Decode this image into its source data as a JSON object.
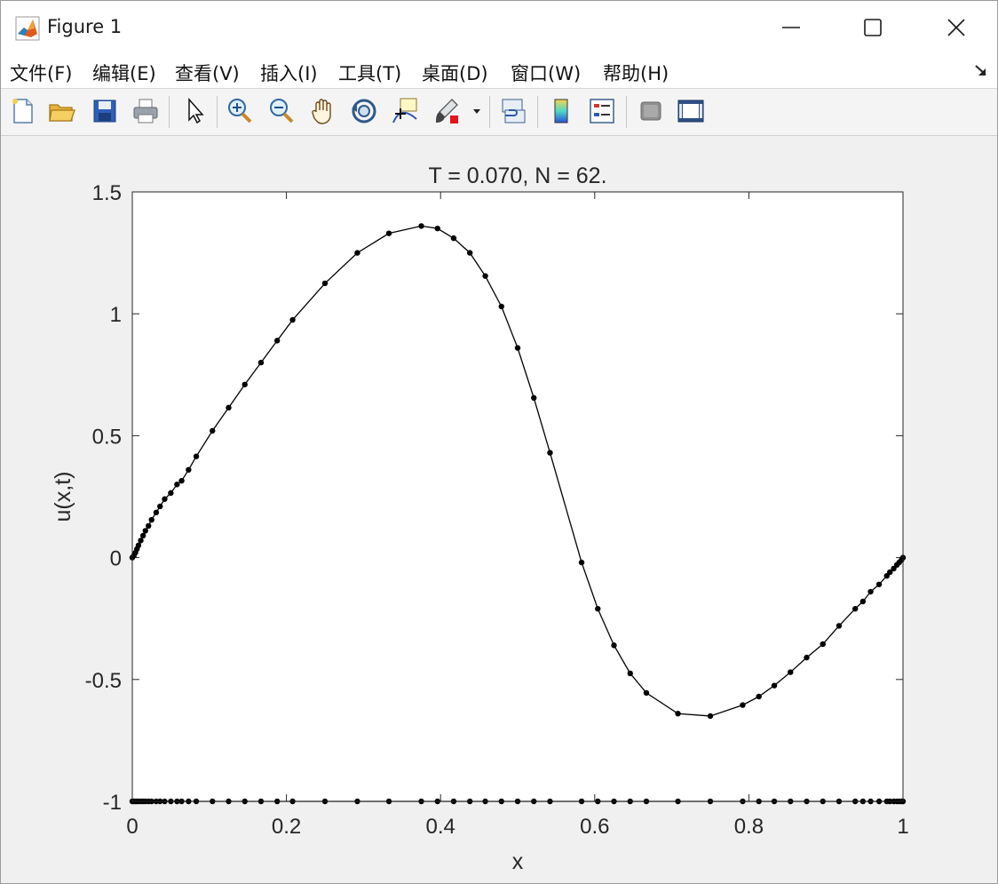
{
  "window": {
    "title": "Figure 1",
    "controls": [
      "minimize",
      "maximize",
      "close"
    ]
  },
  "menu": {
    "items": [
      {
        "label": "文件(F)",
        "name": "file"
      },
      {
        "label": "编辑(E)",
        "name": "edit"
      },
      {
        "label": "查看(V)",
        "name": "view"
      },
      {
        "label": "插入(I)",
        "name": "insert"
      },
      {
        "label": "工具(T)",
        "name": "tools"
      },
      {
        "label": "桌面(D)",
        "name": "desktop"
      },
      {
        "label": "窗口(W)",
        "name": "window"
      },
      {
        "label": "帮助(H)",
        "name": "help"
      }
    ]
  },
  "toolbar": {
    "buttons": [
      "new-figure-icon",
      "open-file-icon",
      "save-icon",
      "print-icon",
      "pointer-icon",
      "zoom-in-icon",
      "zoom-out-icon",
      "pan-hand-icon",
      "rotate-3d-icon",
      "data-cursor-icon",
      "brush-icon",
      "link-plot-icon",
      "colorbar-icon",
      "legend-icon",
      "hide-plot-tools-icon",
      "show-plot-tools-icon"
    ]
  },
  "chart_data": {
    "type": "line",
    "title": "T = 0.070,    N =  62.",
    "xlabel": "x",
    "ylabel": "u(x,t)",
    "xlim": [
      0,
      1
    ],
    "ylim": [
      -1,
      1.5
    ],
    "xticks": [
      "0",
      "0.2",
      "0.4",
      "0.6",
      "0.8",
      "1"
    ],
    "yticks": [
      "-1",
      "-0.5",
      "0",
      "0.5",
      "1",
      "1.5"
    ],
    "grid": false,
    "line_color": "#000000",
    "series": [
      {
        "marker": "dot",
        "x": [
          0,
          0.002,
          0.004,
          0.006,
          0.008,
          0.011,
          0.014,
          0.017,
          0.021,
          0.025,
          0.031,
          0.036,
          0.042,
          0.05,
          0.058,
          0.064,
          0.073,
          0.083,
          0.104,
          0.125,
          0.146,
          0.167,
          0.188,
          0.208,
          0.25,
          0.292,
          0.333,
          0.375,
          0.396,
          0.417,
          0.438,
          0.458,
          0.479,
          0.5,
          0.521,
          0.542,
          0.583,
          0.604,
          0.625,
          0.646,
          0.667,
          0.708,
          0.75,
          0.792,
          0.813,
          0.833,
          0.854,
          0.875,
          0.896,
          0.917,
          0.938,
          0.948,
          0.958,
          0.969,
          0.979,
          0.983,
          0.988,
          0.992,
          0.995,
          0.998,
          1.0
        ],
        "y": [
          0,
          0.008,
          0.02,
          0.035,
          0.05,
          0.07,
          0.09,
          0.11,
          0.13,
          0.155,
          0.185,
          0.21,
          0.24,
          0.265,
          0.3,
          0.315,
          0.36,
          0.415,
          0.52,
          0.615,
          0.71,
          0.8,
          0.89,
          0.975,
          1.125,
          1.25,
          1.33,
          1.36,
          1.35,
          1.31,
          1.25,
          1.155,
          1.03,
          0.86,
          0.655,
          0.43,
          -0.02,
          -0.21,
          -0.36,
          -0.475,
          -0.555,
          -0.64,
          -0.65,
          -0.605,
          -0.57,
          -0.525,
          -0.47,
          -0.41,
          -0.355,
          -0.28,
          -0.21,
          -0.18,
          -0.14,
          -0.11,
          -0.075,
          -0.06,
          -0.045,
          -0.03,
          -0.02,
          -0.01,
          0
        ]
      }
    ],
    "mesh_points_y": -1
  }
}
